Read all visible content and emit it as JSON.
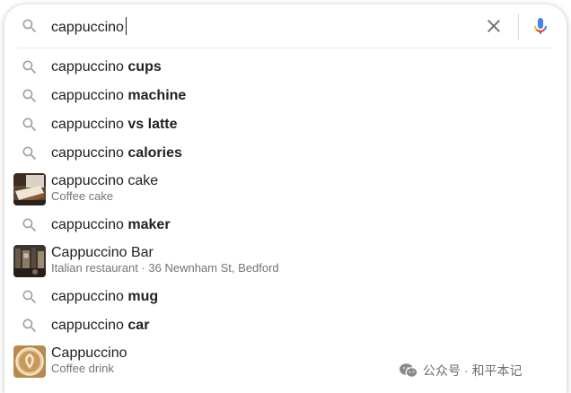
{
  "search": {
    "query": "cappuccino",
    "icons": {
      "search": "search-icon",
      "clear": "close-icon",
      "voice": "microphone-icon"
    }
  },
  "suggestions": [
    {
      "prefix": "cappuccino ",
      "bold": "cups",
      "icon": "search-icon"
    },
    {
      "prefix": "cappuccino ",
      "bold": "machine",
      "icon": "search-icon"
    },
    {
      "prefix": "cappuccino ",
      "bold": "vs latte",
      "icon": "search-icon"
    },
    {
      "prefix": "cappuccino ",
      "bold": "calories",
      "icon": "search-icon"
    },
    {
      "title": "cappuccino cake",
      "subtitle": "Coffee cake",
      "icon": "cake-thumbnail"
    },
    {
      "prefix": "cappuccino ",
      "bold": "maker",
      "icon": "search-icon"
    },
    {
      "title": "Cappuccino Bar",
      "subtitle": "Italian restaurant · 36 Newnham St, Bedford",
      "icon": "restaurant-thumbnail"
    },
    {
      "prefix": "cappuccino ",
      "bold": "mug",
      "icon": "search-icon"
    },
    {
      "prefix": "cappuccino ",
      "bold": "car",
      "icon": "search-icon"
    },
    {
      "title": "Cappuccino",
      "subtitle": "Coffee drink",
      "icon": "coffee-thumbnail"
    }
  ],
  "watermark": {
    "text": "公众号 · 和平本记",
    "icon": "wechat-icon"
  },
  "colors": {
    "text": "#202124",
    "subtext": "#70757a",
    "icon": "#9aa0a6",
    "mic_blue": "#4285f4",
    "mic_red": "#ea4335",
    "mic_yellow": "#fbbc04",
    "mic_green": "#34a853"
  }
}
